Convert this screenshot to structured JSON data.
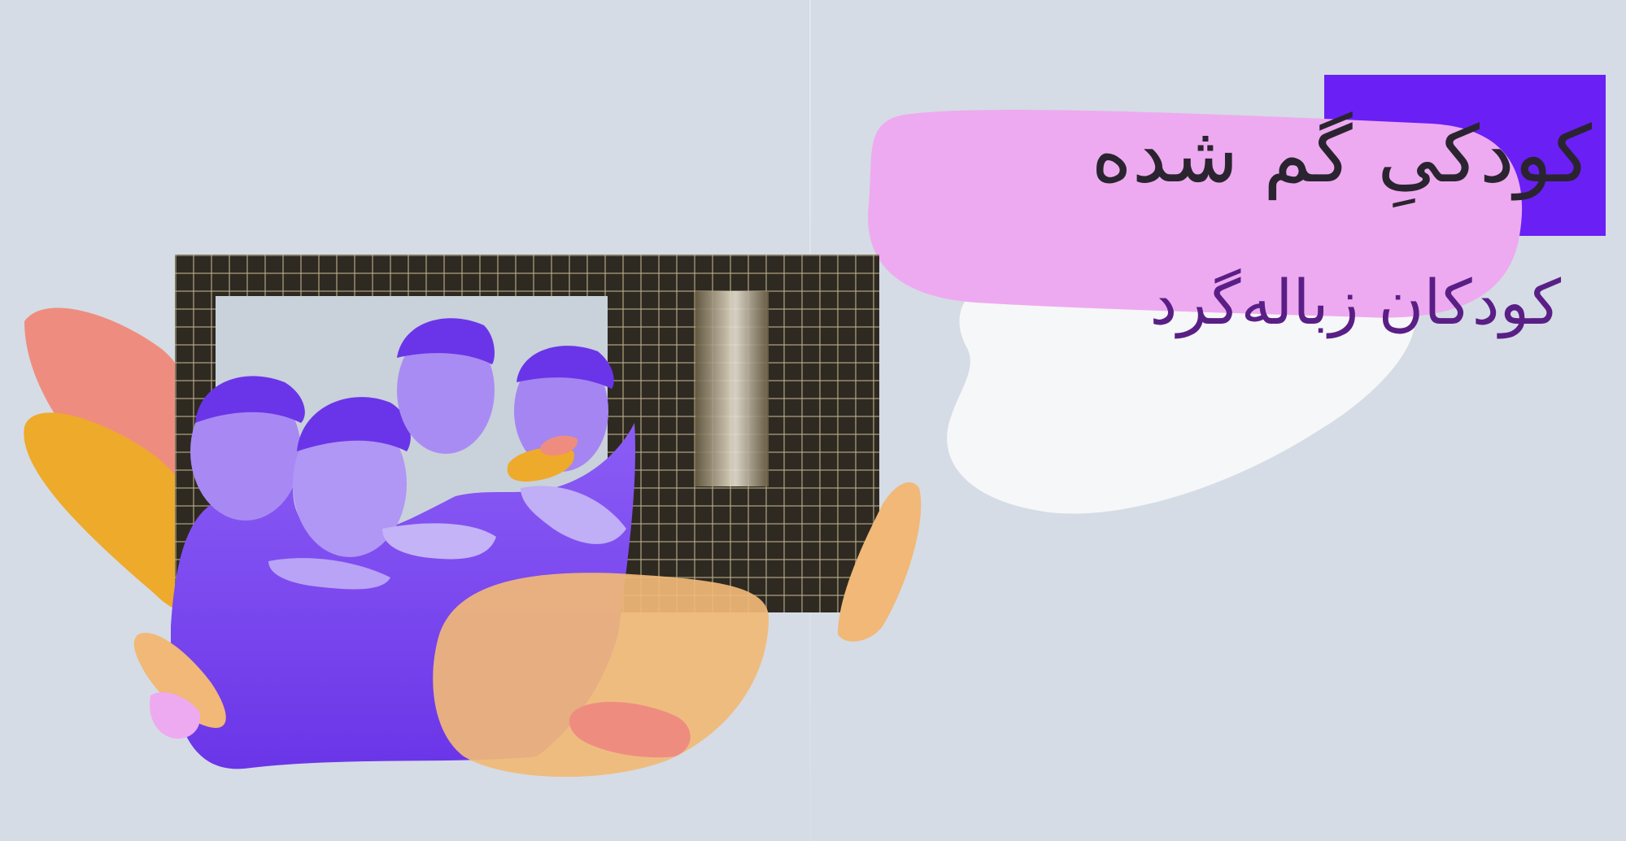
{
  "title": "کودکیِ گم شده",
  "subtitle": "کودکان زباله‌گرد",
  "photo": {
    "subject": "children-group-photo-icon",
    "tint_color": "#7b3ff2"
  },
  "colors": {
    "background": "#d5dce5",
    "violet_block": "#6a1ff5",
    "pink_blob": "#eeaaf0",
    "white_blob": "#f6f7f8",
    "coral": "#ee8d7f",
    "orange": "#eeaa2a",
    "peach": "#f1b877",
    "title_text": "#2a2430",
    "subtitle_text": "#5a1f86"
  }
}
